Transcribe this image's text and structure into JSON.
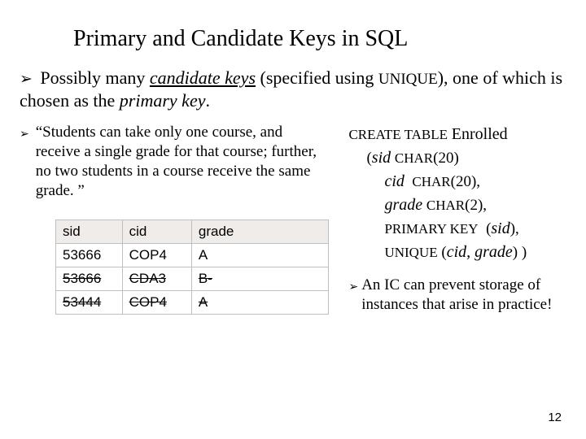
{
  "title": "Primary and Candidate Keys in SQL",
  "top_bullet": {
    "prefix": "Possibly many ",
    "candidate_keys": "candidate keys",
    "mid": "  (specified using ",
    "unique": "UNIQUE",
    "tail": "), one of which is chosen as the ",
    "pk": "primary key",
    "end": "."
  },
  "quote": "“Students can take only one course, and receive a single grade for that course; further, no two students in a course receive the same grade. ”",
  "sql": {
    "l1a": "CREATE TABLE",
    "l1b": "Enrolled",
    "l2a": "(",
    "l2b": "sid",
    "l2c": "CHAR",
    "l2d": "(20)",
    "l3a": "cid",
    "l3b": "CHAR",
    "l3c": "(20),",
    "l4a": "grade",
    "l4b": "CHAR",
    "l4c": "(2),",
    "l5a": "PRIMARY KEY",
    "l5b": "(",
    "l5c": "sid",
    "l5d": "),",
    "l6a": "UNIQUE",
    "l6b": "(",
    "l6c": "cid, grade",
    "l6d": ") )"
  },
  "note": "An IC can prevent storage of instances that arise in practice!",
  "page_number": "12",
  "table": {
    "headers": [
      "sid",
      "cid",
      "grade"
    ],
    "rows": [
      {
        "sid": "53666",
        "cid": "COP4",
        "grade": "A",
        "strike": false
      },
      {
        "sid": "53666",
        "cid": "CDA3",
        "grade": "B-",
        "strike": true
      },
      {
        "sid": "53444",
        "cid": "COP4",
        "grade": "A",
        "strike": true
      }
    ]
  }
}
